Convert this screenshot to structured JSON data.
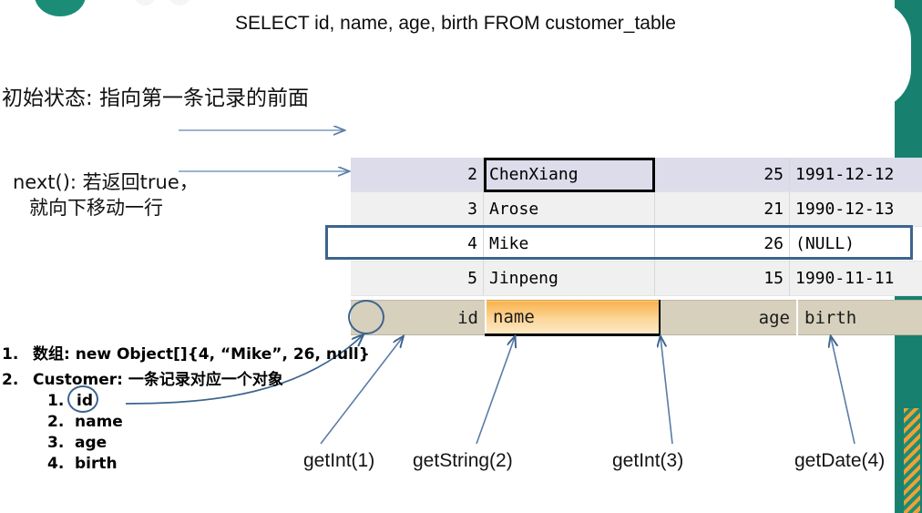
{
  "slide": {
    "title": "SELECT id, name, age, birth FROM customer_table",
    "accent_teal": "#18806f",
    "accent_blue": "#3d648e",
    "accent_orange": "#f8b24d"
  },
  "notes": {
    "initial_state": "初始状态: 指向第一条记录的前面",
    "next_line1": "next(): 若返回true，",
    "next_line2": "就向下移动一行"
  },
  "outline": [
    {
      "num": "1.",
      "text": "数组: new Object[]{4, “Mike”, 26, null}",
      "level": 1
    },
    {
      "num": "2.",
      "text": "Customer: 一条记录对应一个对象",
      "level": 1
    },
    {
      "num": "1.",
      "text": "id",
      "level": 2,
      "circled": true
    },
    {
      "num": "2.",
      "text": "name",
      "level": 2,
      "circled": false
    },
    {
      "num": "3.",
      "text": "age",
      "level": 2,
      "circled": false
    },
    {
      "num": "4.",
      "text": "birth",
      "level": 2,
      "circled": false
    }
  ],
  "result_table": {
    "columns": [
      "id",
      "name",
      "age",
      "birth"
    ],
    "rows": [
      {
        "id": "2",
        "name": "ChenXiang",
        "age": "25",
        "birth": "1991-12-12",
        "style": "selected",
        "focused_cell": "name"
      },
      {
        "id": "3",
        "name": "Arose",
        "age": "21",
        "birth": "1990-12-13",
        "style": "alt",
        "focused_cell": ""
      },
      {
        "id": "4",
        "name": "Mike",
        "age": "26",
        "birth": "(NULL)",
        "style": "plain",
        "focused_cell": ""
      },
      {
        "id": "5",
        "name": "Jinpeng",
        "age": "15",
        "birth": "1990-11-11",
        "style": "alt2",
        "focused_cell": ""
      }
    ],
    "highlighted_column": "name",
    "circled_column": "id"
  },
  "getters": [
    {
      "label": "getInt(1)",
      "column": "id"
    },
    {
      "label": "getString(2)",
      "column": "name"
    },
    {
      "label": "getInt(3)",
      "column": "age"
    },
    {
      "label": "getDate(4)",
      "column": "birth"
    }
  ]
}
